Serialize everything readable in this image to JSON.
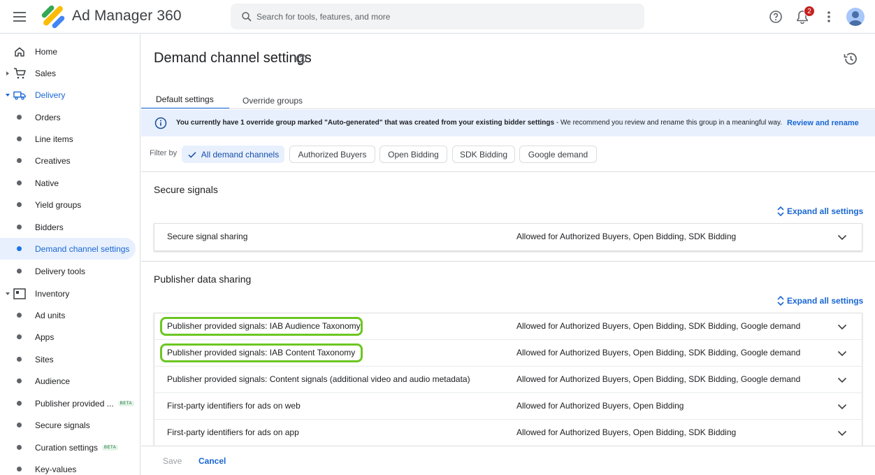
{
  "app": {
    "title": "Ad Manager 360"
  },
  "search": {
    "placeholder": "Search for tools, features, and more"
  },
  "notifications": {
    "count": "2"
  },
  "colors": {
    "accent": "#1a73e8",
    "highlight": "#6cc623",
    "banner_bg": "#e8f0fe"
  },
  "sidebar": {
    "items": [
      {
        "label": "Home",
        "icon": "home-icon"
      },
      {
        "label": "Sales",
        "icon": "cart-icon"
      },
      {
        "label": "Delivery",
        "icon": "truck-icon"
      },
      {
        "label": "Orders"
      },
      {
        "label": "Line items"
      },
      {
        "label": "Creatives"
      },
      {
        "label": "Native"
      },
      {
        "label": "Yield groups"
      },
      {
        "label": "Bidders"
      },
      {
        "label": "Demand channel settings"
      },
      {
        "label": "Delivery tools"
      },
      {
        "label": "Inventory",
        "icon": "inventory-icon"
      },
      {
        "label": "Ad units"
      },
      {
        "label": "Apps"
      },
      {
        "label": "Sites"
      },
      {
        "label": "Audience"
      },
      {
        "label": "Publisher provided ...",
        "badge": "BETA"
      },
      {
        "label": "Secure signals"
      },
      {
        "label": "Curation settings",
        "badge": "BETA"
      },
      {
        "label": "Key-values"
      }
    ]
  },
  "page": {
    "title": "Demand channel settings",
    "tabs": [
      {
        "label": "Default settings"
      },
      {
        "label": "Override groups"
      }
    ],
    "banner": {
      "text_bold": "You currently have 1 override group marked \"Auto-generated\" that was created from your existing bidder settings",
      "text_rest": " - We recommend you review and rename this group in a meaningful way.",
      "link": "Review and rename"
    },
    "filter": {
      "label": "Filter by",
      "chips": [
        {
          "label": "All demand channels"
        },
        {
          "label": "Authorized Buyers"
        },
        {
          "label": "Open Bidding"
        },
        {
          "label": "SDK Bidding"
        },
        {
          "label": "Google demand"
        }
      ]
    },
    "sections": [
      {
        "title": "Secure signals",
        "expand": "Expand all settings",
        "rows": [
          {
            "name": "Secure signal sharing",
            "value": "Allowed for Authorized Buyers, Open Bidding, SDK Bidding"
          }
        ]
      },
      {
        "title": "Publisher data sharing",
        "expand": "Expand all settings",
        "rows": [
          {
            "name": "Publisher provided signals: IAB Audience Taxonomy",
            "value": "Allowed for Authorized Buyers, Open Bidding, SDK Bidding, Google demand"
          },
          {
            "name": "Publisher provided signals: IAB Content Taxonomy",
            "value": "Allowed for Authorized Buyers, Open Bidding, SDK Bidding, Google demand"
          },
          {
            "name": "Publisher provided signals: Content signals (additional video and audio metadata)",
            "value": "Allowed for Authorized Buyers, Open Bidding, SDK Bidding, Google demand"
          },
          {
            "name": "First-party identifiers for ads on web",
            "value": "Allowed for Authorized Buyers, Open Bidding"
          },
          {
            "name": "First-party identifiers for ads on app",
            "value": "Allowed for Authorized Buyers, Open Bidding, SDK Bidding"
          }
        ]
      }
    ],
    "footer": {
      "save": "Save",
      "cancel": "Cancel"
    }
  }
}
